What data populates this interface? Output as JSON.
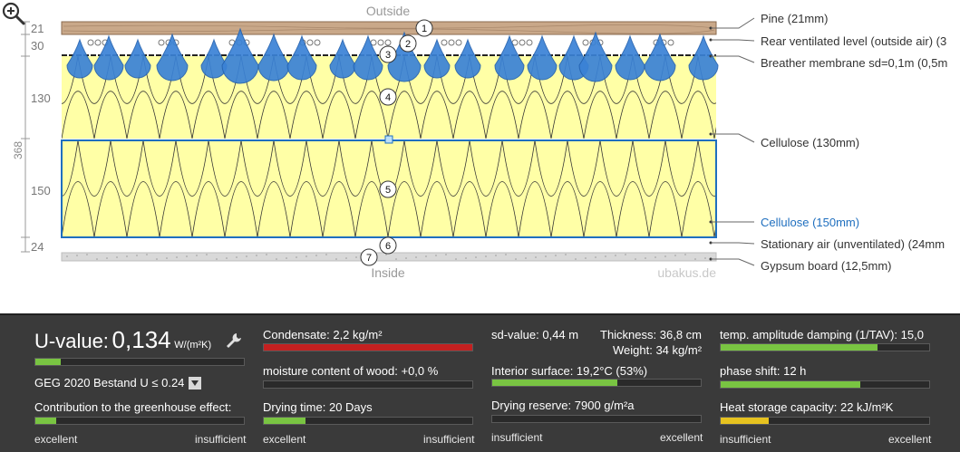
{
  "diagram": {
    "outside_label": "Outside",
    "inside_label": "Inside",
    "watermark": "ubakus.de",
    "total_thickness": "368",
    "dimensions": [
      "21",
      "30",
      "130",
      "150",
      "24"
    ],
    "layer_markers": [
      "1",
      "2",
      "3",
      "4",
      "5",
      "6",
      "7"
    ],
    "layer_labels": [
      "Pine (21mm)",
      "Rear ventilated level (outside air) (3",
      "Breather membrane sd=0,1m (0,5m",
      "Cellulose (130mm)",
      "Cellulose (150mm)",
      "Stationary air (unventilated) (24mm",
      "Gypsum board (12,5mm)"
    ],
    "colors": {
      "wood": "#c9a889",
      "cellulose": "#ffffa6",
      "gypsum": "#d9d9d9",
      "droplet": "#3a82d6",
      "selected_outline": "#1f6fbf",
      "selected_label": "#1f6fbf"
    },
    "zoom_icon": "zoom-in-icon"
  },
  "panel": {
    "u_value": {
      "label": "U-value:",
      "value": "0,134",
      "unit": "W/(m²K)",
      "standard": "GEG 2020 Bestand U ≤ 0.24",
      "fill": 0.12
    },
    "greenhouse": {
      "label": "Contribution to the greenhouse effect:",
      "fill": 0.1
    },
    "scale_left": {
      "excellent": "excellent",
      "insufficient": "insufficient"
    },
    "condensate": {
      "label": "Condensate: 2,2 kg/m²",
      "fill": 1.0
    },
    "wood_moisture": {
      "label": "moisture content of wood: +0,0 %",
      "fill": 0.0
    },
    "drying_time": {
      "label": "Drying time: 20 Days",
      "fill": 0.2
    },
    "sd_value": {
      "label": "sd-value: 0,44 m"
    },
    "thickness": {
      "label": "Thickness: 36,8 cm"
    },
    "weight": {
      "label": "Weight: 34 kg/m²"
    },
    "interior_surface": {
      "label": "Interior surface: 19,2°C (53%)",
      "fill": 0.6
    },
    "drying_reserve": {
      "label": "Drying reserve: 7900 g/m²a"
    },
    "scale_mid": {
      "insufficient": "insufficient",
      "excellent": "excellent"
    },
    "temp_amplitude": {
      "label": "temp. amplitude damping (1/TAV): 15,0",
      "fill": 0.75
    },
    "phase_shift": {
      "label": "phase shift: 12 h",
      "fill": 0.67
    },
    "heat_storage": {
      "label": "Heat storage capacity: 22 kJ/m²K",
      "fill": 0.23
    },
    "scale_right": {
      "insufficient": "insufficient",
      "excellent": "excellent"
    },
    "colors": {
      "good": "#79c442",
      "bad": "#c42020",
      "mid": "#e6c21f",
      "panel": "#3a3a3a"
    }
  }
}
